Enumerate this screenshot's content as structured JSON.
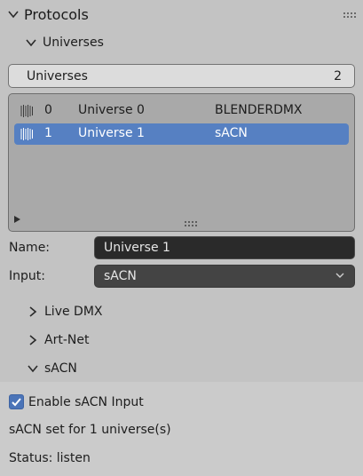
{
  "panel": {
    "title": "Protocols"
  },
  "universes_panel": {
    "title": "Universes",
    "count_label": "Universes",
    "count_value": "2"
  },
  "universe_list": [
    {
      "index": "0",
      "name": "Universe 0",
      "input": "BLENDERDMX",
      "selected": false
    },
    {
      "index": "1",
      "name": "Universe 1",
      "input": "sACN",
      "selected": true
    }
  ],
  "properties": {
    "name_label": "Name:",
    "name_value": "Universe 1",
    "input_label": "Input:",
    "input_value": "sACN"
  },
  "subpanels": {
    "live_dmx": "Live DMX",
    "art_net": "Art-Net",
    "sacn": "sACN"
  },
  "sacn": {
    "enable_label": "Enable sACN Input",
    "enabled": true,
    "set_text": "sACN set for 1 universe(s)",
    "status_text": "Status: listen"
  },
  "colors": {
    "background": "#c3c3c3",
    "accent": "#5680c2",
    "field_dark": "#2a2a2a"
  }
}
